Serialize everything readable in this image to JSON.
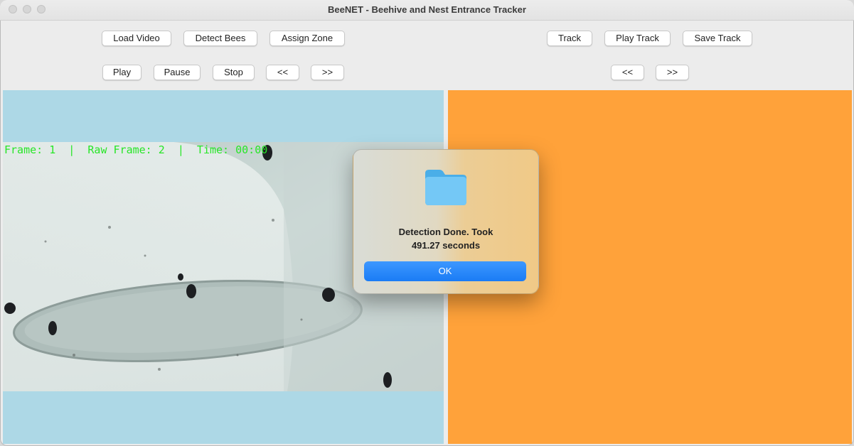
{
  "window": {
    "title": "BeeNET - Beehive and Nest Entrance Tracker"
  },
  "toolbar": {
    "load_video": "Load Video",
    "detect_bees": "Detect Bees",
    "assign_zone": "Assign Zone",
    "play": "Play",
    "pause": "Pause",
    "stop": "Stop",
    "prev": "<<",
    "next": ">>"
  },
  "track_toolbar": {
    "track": "Track",
    "play_track": "Play Track",
    "save_track": "Save Track",
    "prev": "<<",
    "next": ">>"
  },
  "video": {
    "overlay": "Frame: 1  |  Raw Frame: 2  |  Time: 00:00"
  },
  "dialog": {
    "icon": "folder-icon",
    "message_line1": "Detection Done. Took",
    "message_line2": "491.27 seconds",
    "ok_label": "OK"
  },
  "colors": {
    "left_panel": "#add8e6",
    "right_panel": "#ffa23a",
    "overlay_text": "#27e627",
    "ok_button": "#1a7cf5"
  }
}
